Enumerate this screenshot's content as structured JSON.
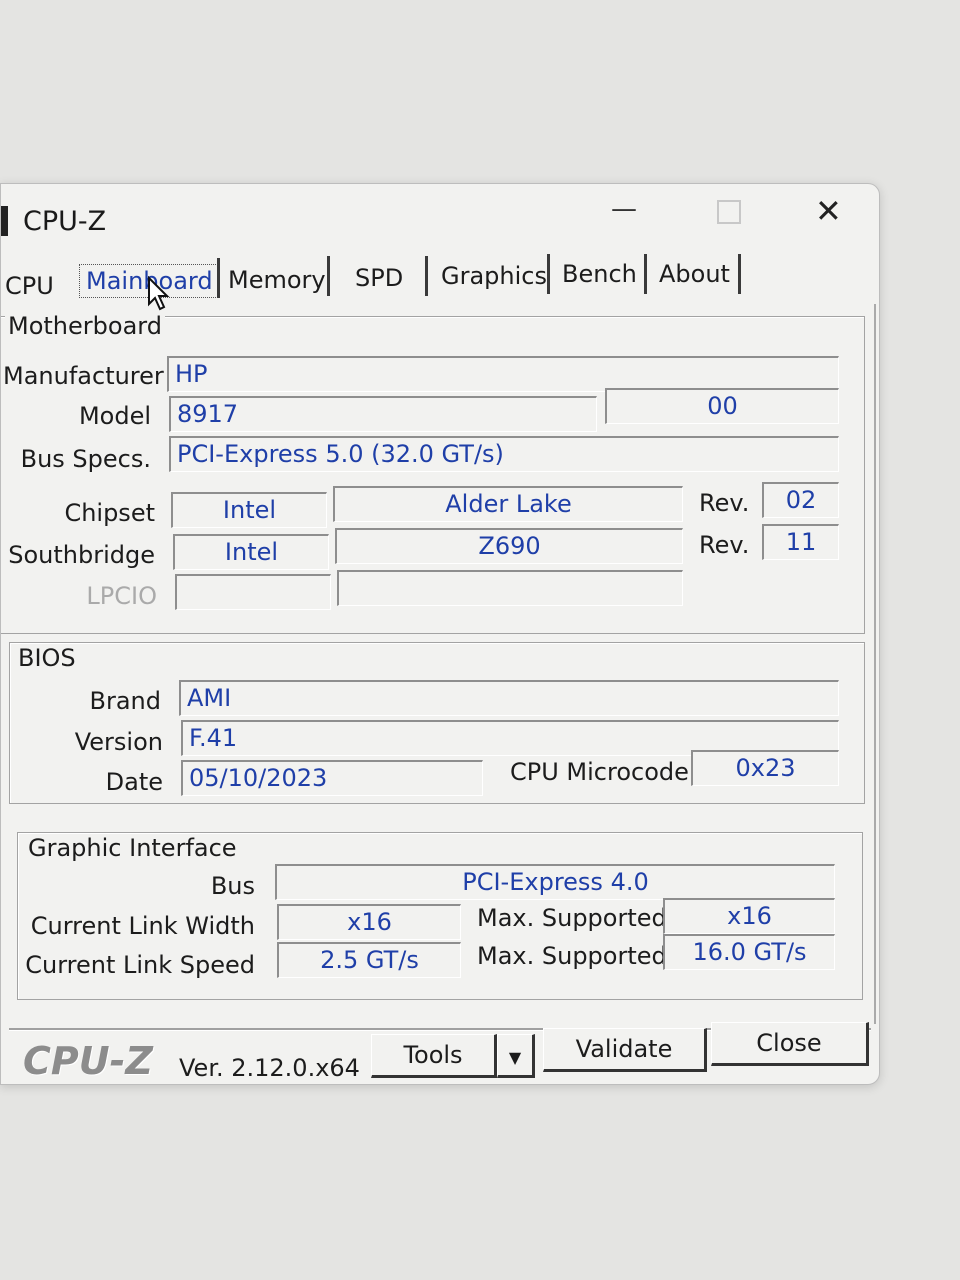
{
  "window": {
    "title": "CPU-Z",
    "minimize_glyph": "—",
    "maximize_glyph": "☐",
    "close_glyph": "✕"
  },
  "tabs": [
    "CPU",
    "Mainboard",
    "Memory",
    "SPD",
    "Graphics",
    "Bench",
    "About"
  ],
  "motherboard": {
    "group_label": "Motherboard",
    "manufacturer_label": "Manufacturer",
    "manufacturer": "HP",
    "model_label": "Model",
    "model": "8917",
    "model_rev": "00",
    "bus_label": "Bus Specs.",
    "bus": "PCI-Express 5.0 (32.0 GT/s)",
    "chipset_label": "Chipset",
    "chipset_vendor": "Intel",
    "chipset_model": "Alder Lake",
    "rev_label": "Rev.",
    "chipset_rev": "02",
    "southbridge_label": "Southbridge",
    "southbridge_vendor": "Intel",
    "southbridge_model": "Z690",
    "southbridge_rev": "11",
    "lpcio_label": "LPCIO"
  },
  "bios": {
    "group_label": "BIOS",
    "brand_label": "Brand",
    "brand": "AMI",
    "version_label": "Version",
    "version": "F.41",
    "date_label": "Date",
    "date": "05/10/2023",
    "microcode_label": "CPU Microcode",
    "microcode": "0x23"
  },
  "graphic": {
    "group_label": "Graphic Interface",
    "bus_label": "Bus",
    "bus": "PCI-Express 4.0",
    "width_label": "Current Link Width",
    "width": "x16",
    "max_label": "Max. Supported",
    "max_width": "x16",
    "speed_label": "Current Link Speed",
    "speed": "2.5 GT/s",
    "max_speed": "16.0 GT/s"
  },
  "footer": {
    "logo": "CPU-Z",
    "version": "Ver. 2.12.0.x64",
    "tools": "Tools",
    "validate": "Validate",
    "close": "Close",
    "dropdown_glyph": "▼"
  }
}
